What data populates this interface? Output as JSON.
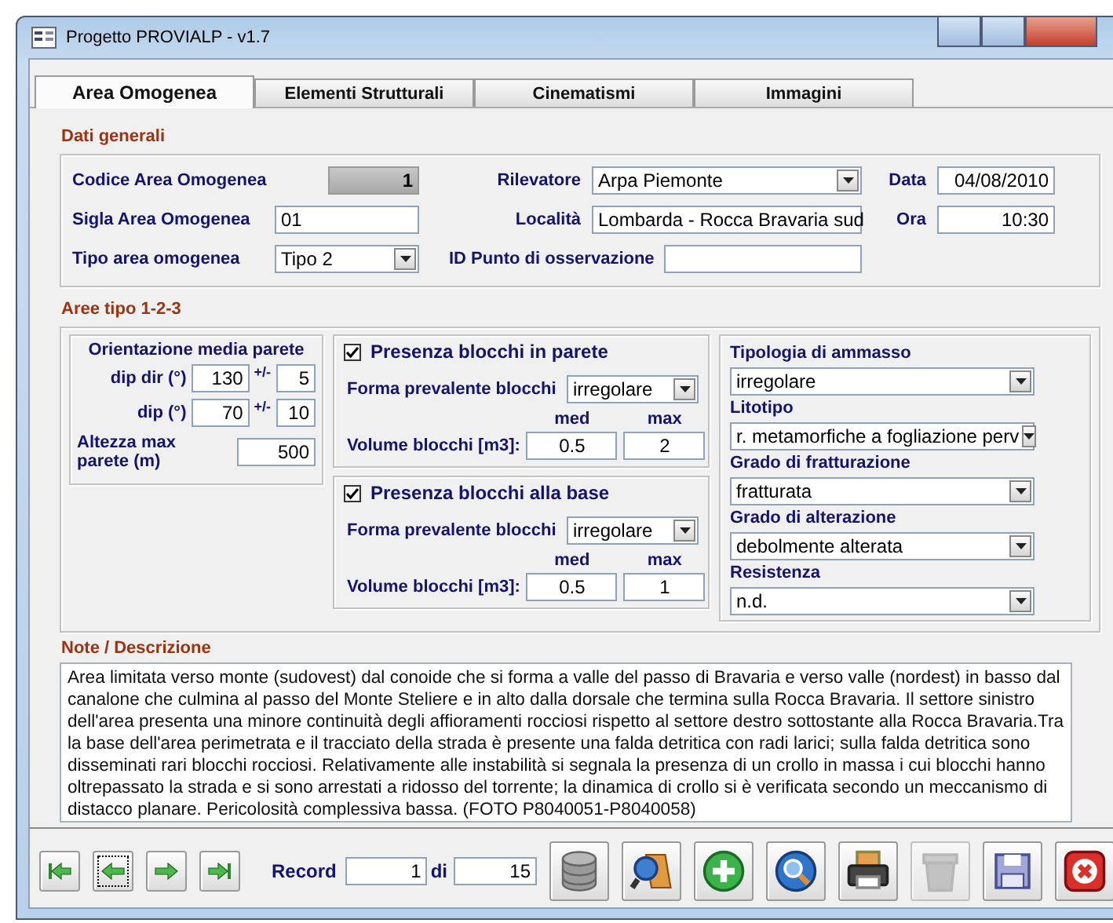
{
  "window": {
    "title": "Progetto PROVIALP - v1.7"
  },
  "tabs": [
    {
      "label": "Area Omogenea",
      "selected": true
    },
    {
      "label": "Elementi Strutturali",
      "selected": false
    },
    {
      "label": "Cinematismi",
      "selected": false
    },
    {
      "label": "Immagini",
      "selected": false
    }
  ],
  "general": {
    "heading": "Dati generali",
    "fields": [
      {
        "label": "Codice Area Omogenea",
        "kind": "readonly",
        "value": "1"
      },
      {
        "label": "Rilevatore",
        "kind": "combo",
        "value": "Arpa Piemonte"
      },
      {
        "label": "Data",
        "kind": "text",
        "value": "04/08/2010"
      },
      {
        "label": "Sigla Area Omogenea",
        "kind": "text",
        "value": "01"
      },
      {
        "label": "Località",
        "kind": "text",
        "value": "Lombarda - Rocca Bravaria sud"
      },
      {
        "label": "Ora",
        "kind": "text",
        "value": "10:30"
      },
      {
        "label": "Tipo area omogenea",
        "kind": "combo",
        "value": "Tipo 2"
      },
      {
        "label": "ID Punto di osservazione",
        "kind": "text"
      }
    ]
  },
  "areas": {
    "heading": "Aree tipo 1-2-3",
    "orientation": {
      "title": "Orientazione media parete",
      "rows": [
        {
          "label": "dip dir (°)",
          "value": "130",
          "tolerance_label": "+/-",
          "tolerance": "5"
        },
        {
          "label": "dip (°)",
          "value": "70",
          "tolerance_label": "+/-",
          "tolerance": "10"
        }
      ],
      "height": {
        "label": "Altezza max parete (m)",
        "value": "500"
      }
    },
    "blocks": [
      {
        "label": "Presenza blocchi in parete",
        "checked": true,
        "shape_label": "Forma prevalente blocchi",
        "shape": "irregolare",
        "med_label": "med",
        "max_label": "max",
        "volume_label": "Volume blocchi [m3]:",
        "med": "0.5",
        "max": "2"
      },
      {
        "label": "Presenza blocchi alla base",
        "checked": true,
        "shape_label": "Forma prevalente blocchi",
        "shape": "irregolare",
        "med_label": "med",
        "max_label": "max",
        "volume_label": "Volume blocchi [m3]:",
        "med": "0.5",
        "max": "1"
      }
    ],
    "properties": [
      {
        "label": "Tipologia di ammasso",
        "value": "irregolare"
      },
      {
        "label": "Litotipo",
        "value": "r. metamorfiche a fogliazione perv"
      },
      {
        "label": "Grado di fratturazione",
        "value": "fratturata"
      },
      {
        "label": "Grado di alterazione",
        "value": "debolmente alterata"
      },
      {
        "label": "Resistenza",
        "value": "n.d."
      }
    ]
  },
  "notes": {
    "heading": "Note / Descrizione",
    "text": "Area limitata verso monte (sudovest) dal conoide che si forma a valle del passo di Bravaria e verso valle (nordest) in basso dal canalone che culmina al passo del Monte Steliere e in alto dalla dorsale che termina sulla Rocca Bravaria. Il settore sinistro dell'area presenta una minore continuità degli affioramenti rocciosi rispetto al settore destro sottostante alla Rocca Bravaria.Tra la base dell'area perimetrata e il tracciato della strada è presente una falda detritica con radi larici; sulla falda detritica sono disseminati rari blocchi rocciosi. Relativamente alle instabilità si segnala la presenza di un crollo in massa i cui blocchi hanno oltrepassato la strada e si sono arrestati a ridosso del torrente; la dinamica di crollo si è verificata secondo un meccanismo di distacco planare. Pericolosità complessiva bassa. (FOTO P8040051-P8040058)"
  },
  "footer": {
    "nav": [
      {
        "kind": "first",
        "focused": false
      },
      {
        "kind": "previous",
        "focused": true
      },
      {
        "kind": "next",
        "focused": false
      },
      {
        "kind": "last",
        "focused": false
      }
    ],
    "record_label": "Record",
    "record": "1",
    "of_label": "di",
    "total": "15",
    "actions": [
      {
        "kind": "database",
        "disabled": false
      },
      {
        "kind": "search",
        "disabled": false
      },
      {
        "kind": "add",
        "disabled": false
      },
      {
        "kind": "globe",
        "disabled": false
      },
      {
        "kind": "print",
        "disabled": false
      },
      {
        "kind": "trash",
        "disabled": true
      },
      {
        "kind": "save",
        "disabled": false
      },
      {
        "kind": "close",
        "disabled": false
      }
    ]
  }
}
